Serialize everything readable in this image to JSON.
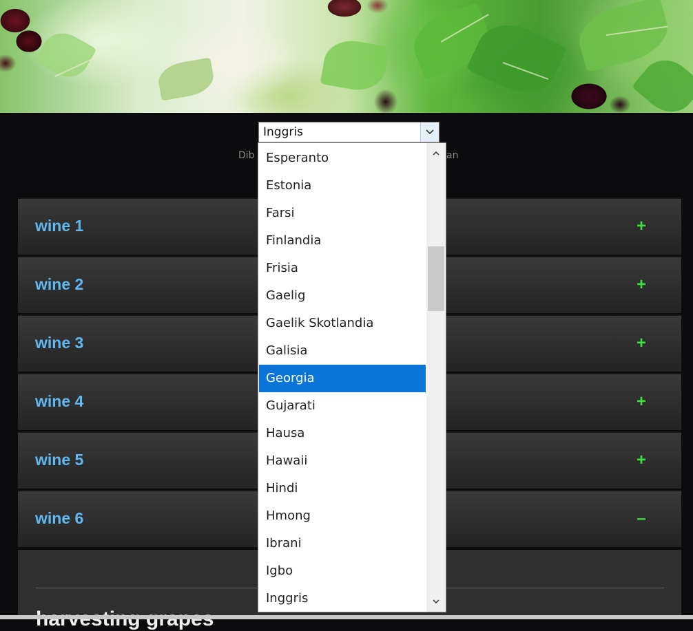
{
  "language_select": {
    "current_value": "Inggris",
    "powered_by_prefix": "Dib",
    "powered_by_suffix": "an",
    "options": [
      "Esperanto",
      "Estonia",
      "Farsi",
      "Finlandia",
      "Frisia",
      "Gaelig",
      "Gaelik Skotlandia",
      "Galisia",
      "Georgia",
      "Gujarati",
      "Hausa",
      "Hawaii",
      "Hindi",
      "Hmong",
      "Ibrani",
      "Igbo",
      "Inggris"
    ],
    "highlighted_option": "Georgia"
  },
  "accordion": {
    "items": [
      {
        "title": "wine 1",
        "state": "+"
      },
      {
        "title": "wine 2",
        "state": "+"
      },
      {
        "title": "wine 3",
        "state": "+"
      },
      {
        "title": "wine 4",
        "state": "+"
      },
      {
        "title": "wine 5",
        "state": "+"
      },
      {
        "title": "wine 6",
        "state": "–"
      }
    ],
    "expanded_heading": "harvesting grapes"
  },
  "colors": {
    "title_blue": "#5fb8f0",
    "toggle_green": "#3fdc3f",
    "selection_blue": "#0a74d8",
    "page_bg": "#0c0c0e"
  }
}
